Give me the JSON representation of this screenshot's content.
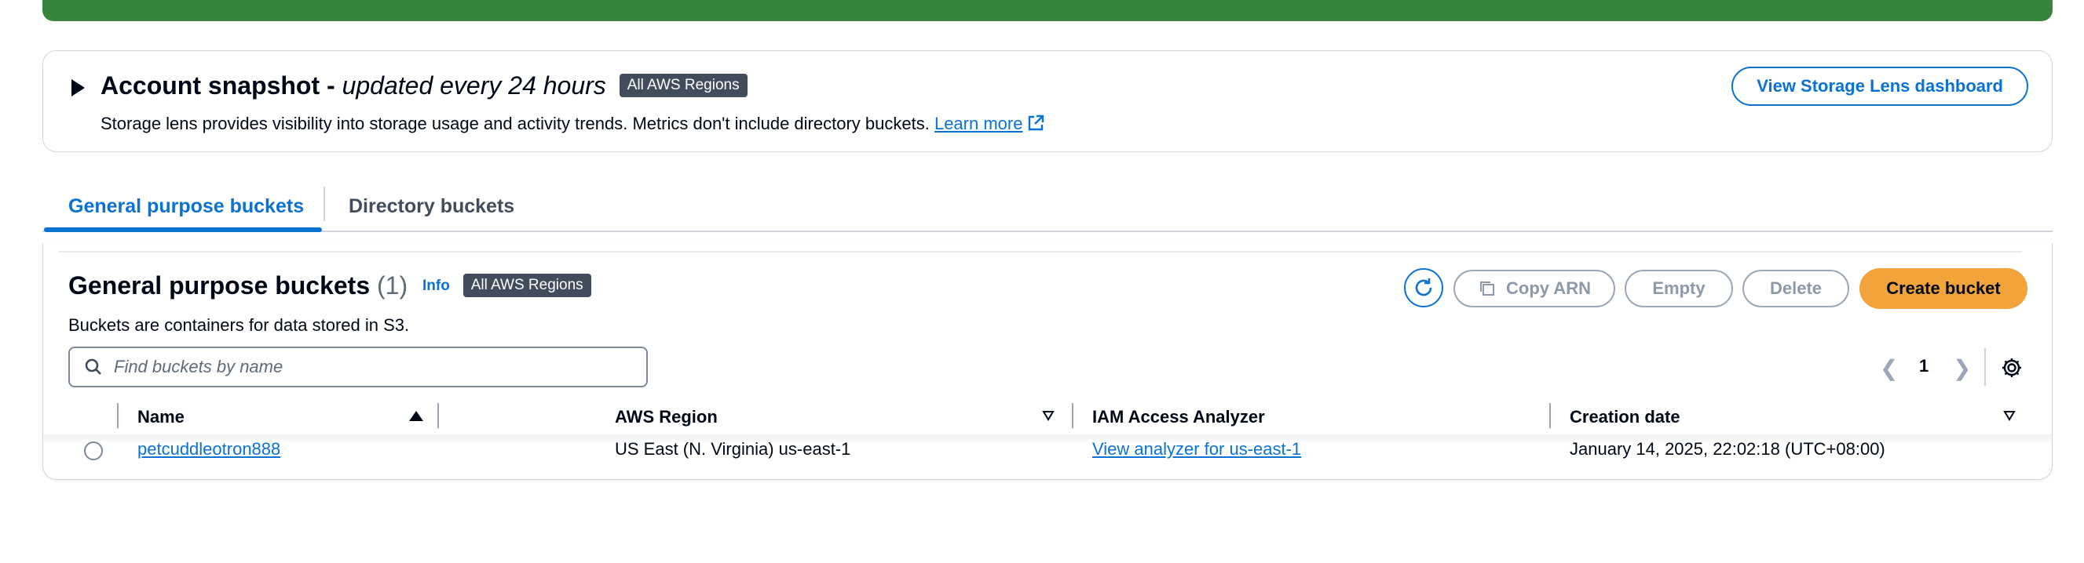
{
  "snapshot": {
    "title": "Account snapshot",
    "title_dash": " - ",
    "title_suffix": "updated every 24 hours",
    "badge": "All AWS Regions",
    "description": "Storage lens provides visibility into storage usage and activity trends. Metrics don't include directory buckets.",
    "learn_more": "Learn more",
    "dashboard_button": "View Storage Lens dashboard"
  },
  "tabs": [
    {
      "label": "General purpose buckets",
      "active": true
    },
    {
      "label": "Directory buckets",
      "active": false
    }
  ],
  "panel": {
    "title": "General purpose buckets",
    "count": "(1)",
    "info": "Info",
    "badge": "All AWS Regions",
    "description": "Buckets are containers for data stored in S3."
  },
  "actions": {
    "copy_arn": "Copy ARN",
    "empty": "Empty",
    "delete": "Delete",
    "create": "Create bucket"
  },
  "search": {
    "placeholder": "Find buckets by name",
    "value": ""
  },
  "pagination": {
    "current_page": "1"
  },
  "table": {
    "columns": [
      "Name",
      "AWS Region",
      "IAM Access Analyzer",
      "Creation date"
    ],
    "rows": [
      {
        "name": "petcuddleotron888",
        "region": "US East (N. Virginia) us-east-1",
        "analyzer": "View analyzer for us-east-1",
        "created": "January 14, 2025, 22:02:18 (UTC+08:00)"
      }
    ]
  },
  "colors": {
    "banner": "#37843b",
    "link": "#0972d3",
    "primary_button": "#f2a33a",
    "badge": "#414d5c"
  },
  "icons": [
    "caret-right-icon",
    "external-link-icon",
    "refresh-icon",
    "copy-icon",
    "search-icon",
    "chevron-left-icon",
    "chevron-right-icon",
    "settings-icon",
    "sort-asc-icon",
    "sort-icon"
  ]
}
